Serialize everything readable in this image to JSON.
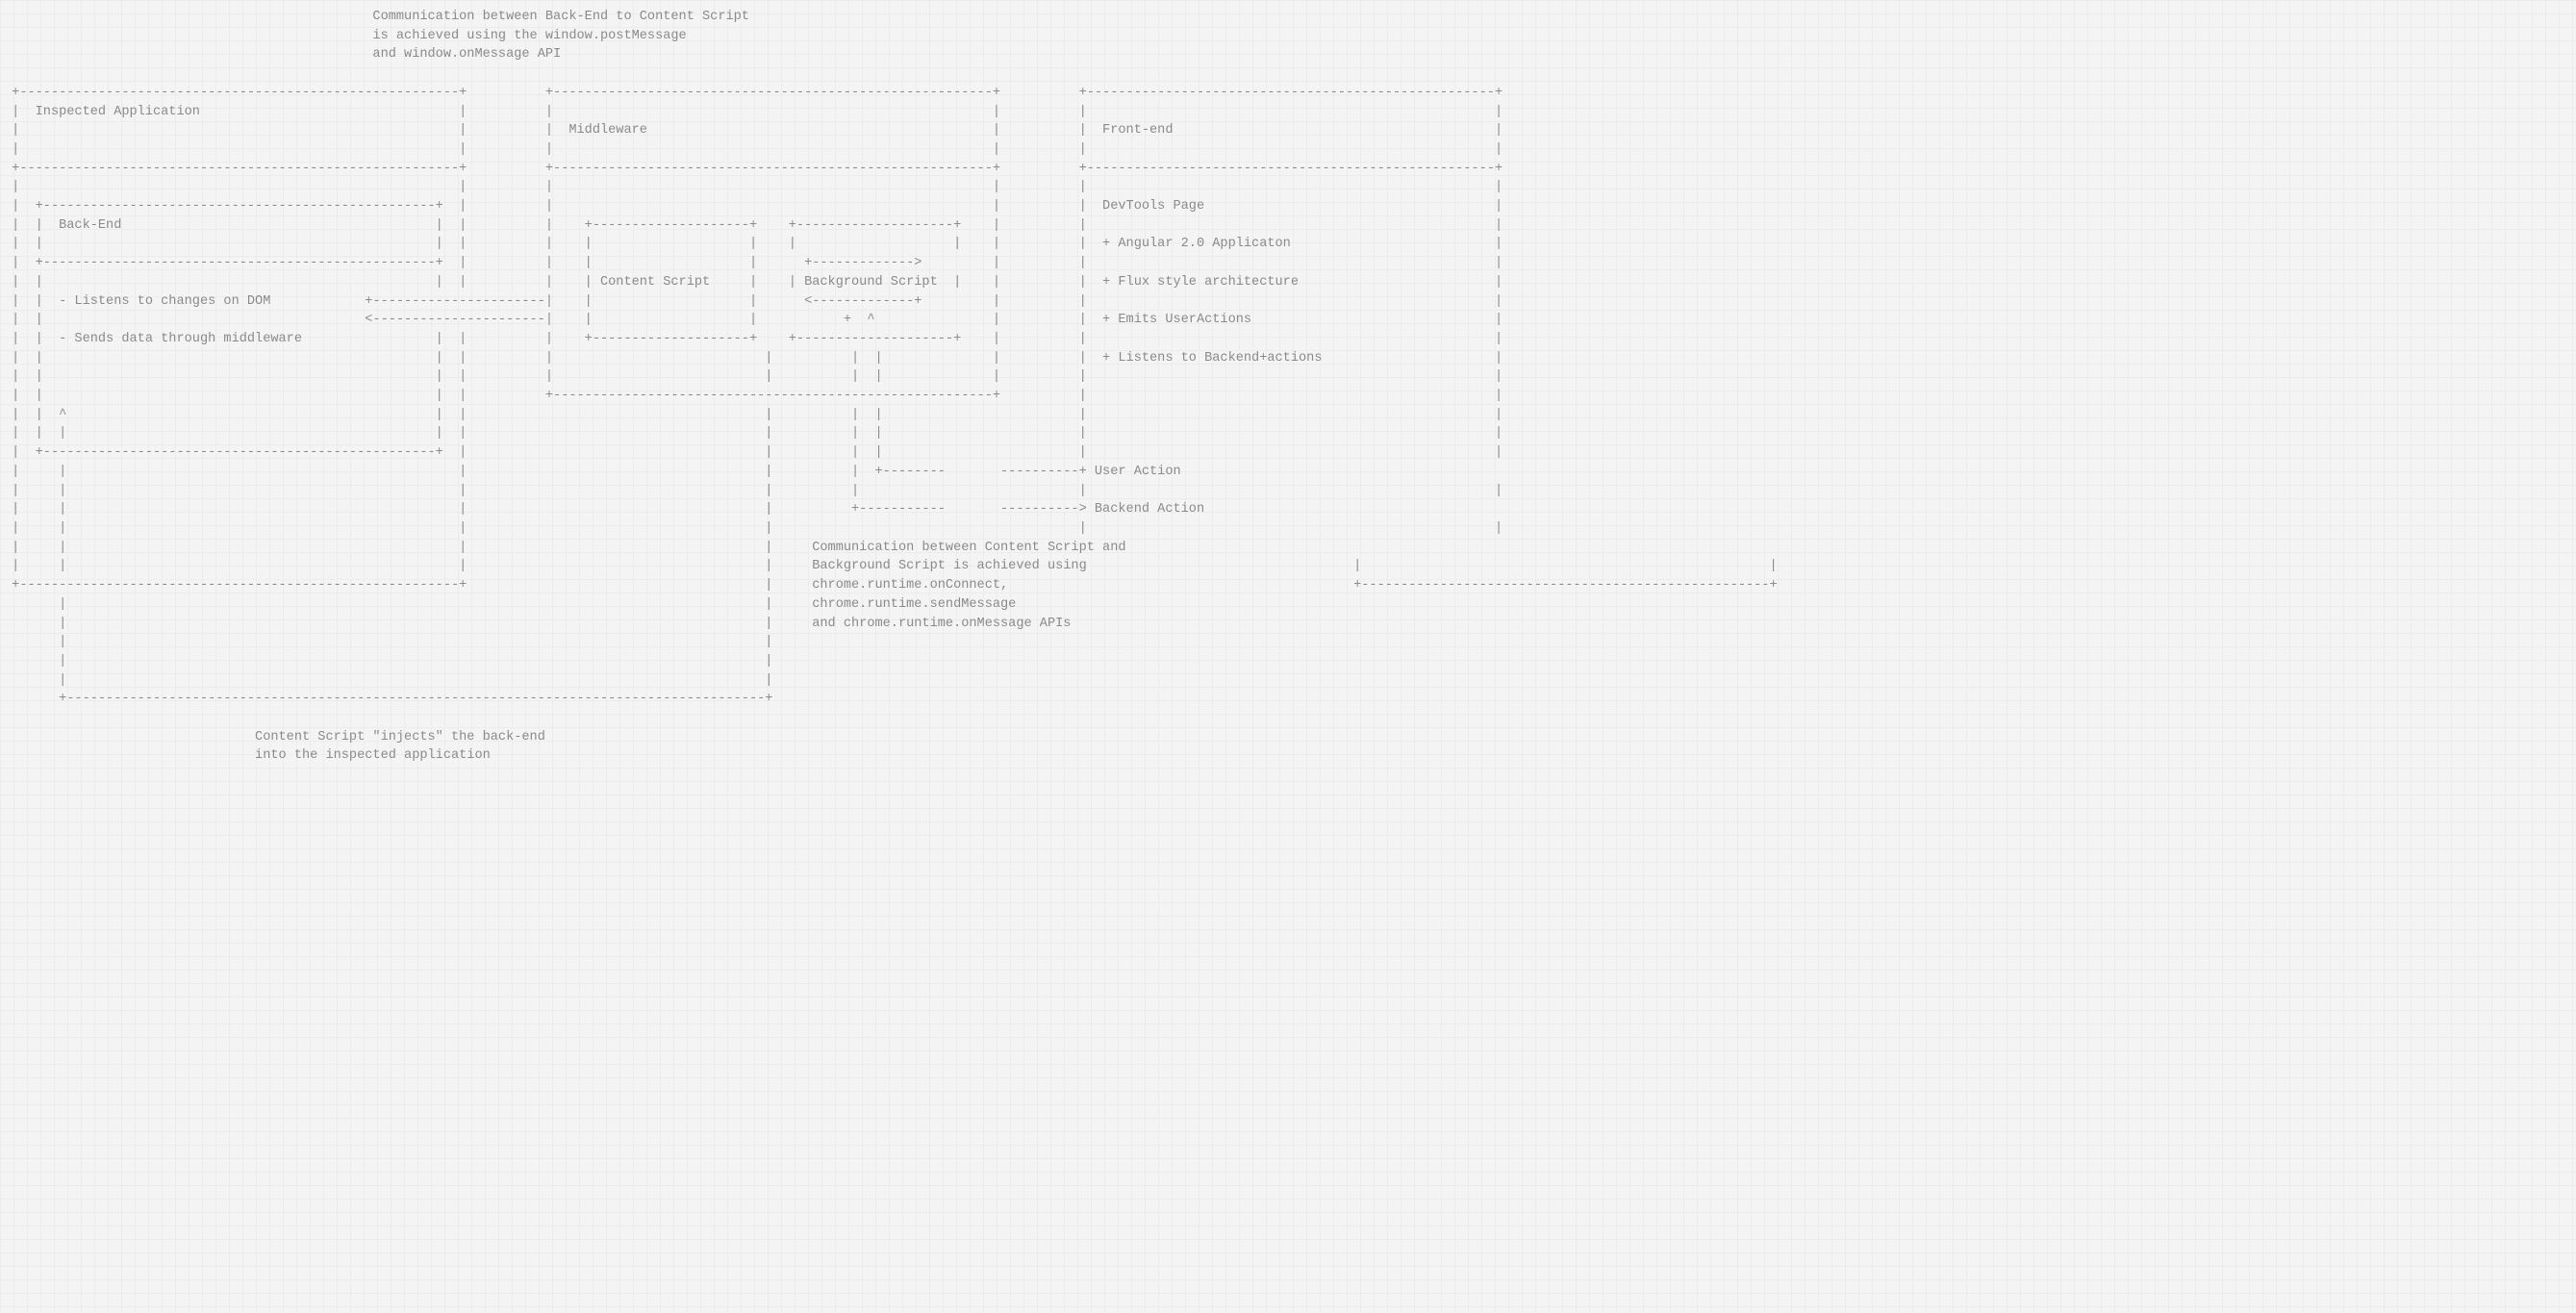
{
  "note_top": {
    "l1": "Communication between Back-End to Content Script",
    "l2": "is achieved using the window.postMessage",
    "l3": "and window.onMessage API"
  },
  "col_left": {
    "title": "Inspected Application",
    "inner_title": "Back-End",
    "bullet1": "- Listens to changes on DOM",
    "bullet2": "- Sends data through middleware"
  },
  "col_mid": {
    "title": "Middleware",
    "box_left": "Content Script",
    "box_right": "Background Script"
  },
  "col_right": {
    "title": "Front-end",
    "inner_title": "DevTools Page",
    "b1": "+ Angular 2.0 Applicaton",
    "b2": "+ Flux style architecture",
    "b3": "+ Emits UserActions",
    "b4": "+ Listens to Backend+actions"
  },
  "label_user_action": "User Action",
  "label_backend_action": "Backend Action",
  "note_mid": {
    "l1": "Communication between Content Script and",
    "l2": "Background Script is achieved using",
    "l3": "chrome.runtime.onConnect,",
    "l4": "chrome.runtime.sendMessage",
    "l5": "and chrome.runtime.onMessage APIs"
  },
  "note_bottom": {
    "l1": "Content Script \"injects\" the back-end",
    "l2": "into the inspected application"
  }
}
